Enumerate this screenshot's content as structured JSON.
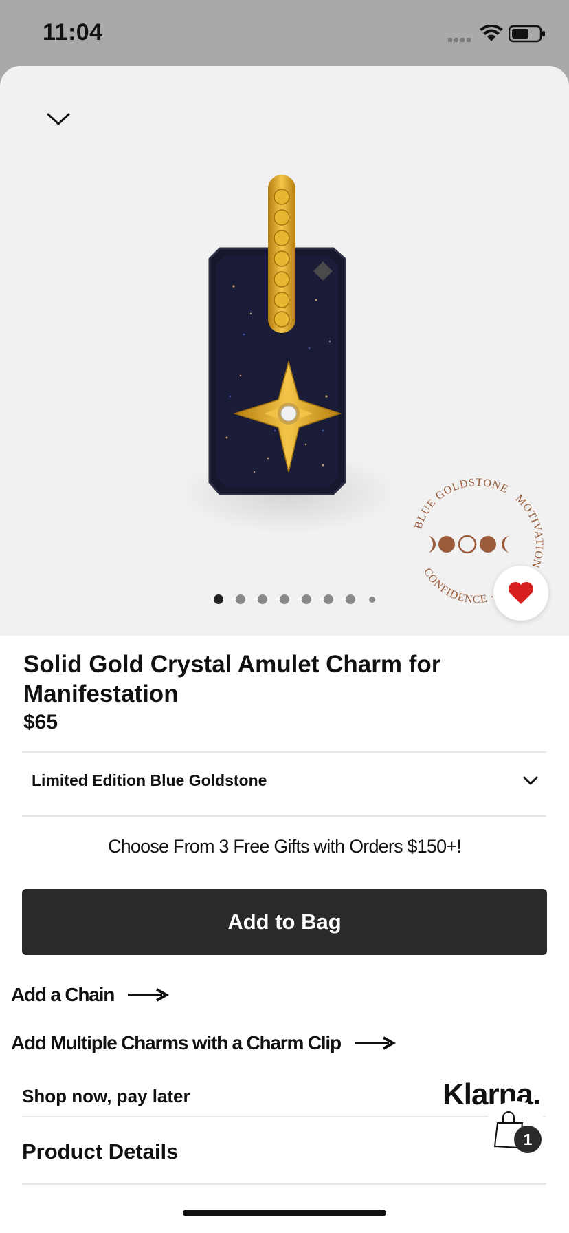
{
  "status_bar": {
    "time": "11:04"
  },
  "product": {
    "title": "Solid Gold Crystal Amulet Charm for Manifestation",
    "price": "$65",
    "favorited": true
  },
  "gallery": {
    "image_count": 8,
    "active_index": 0
  },
  "stamp": {
    "text_top": "BLUE GOLDSTONE",
    "text_right": "MOTIVATION",
    "text_bottom": "CONFIDENCE · IN"
  },
  "variant": {
    "selected": "Limited Edition Blue Goldstone"
  },
  "promo": {
    "text": "Choose From 3 Free Gifts with Orders $150+!"
  },
  "actions": {
    "add_to_bag": "Add to Bag",
    "add_chain": "Add a Chain",
    "add_multiple": "Add Multiple Charms with a Charm Clip"
  },
  "payment": {
    "text": "Shop now, pay later",
    "provider": "Klarna."
  },
  "sections": {
    "product_details": "Product Details"
  },
  "cart": {
    "count": "1"
  },
  "colors": {
    "button_bg": "#2a2a2a",
    "heart": "#d81e1e",
    "stamp_brown": "#9a5b3a",
    "gold": "#d9a520",
    "stone": "#1a1a3a"
  }
}
